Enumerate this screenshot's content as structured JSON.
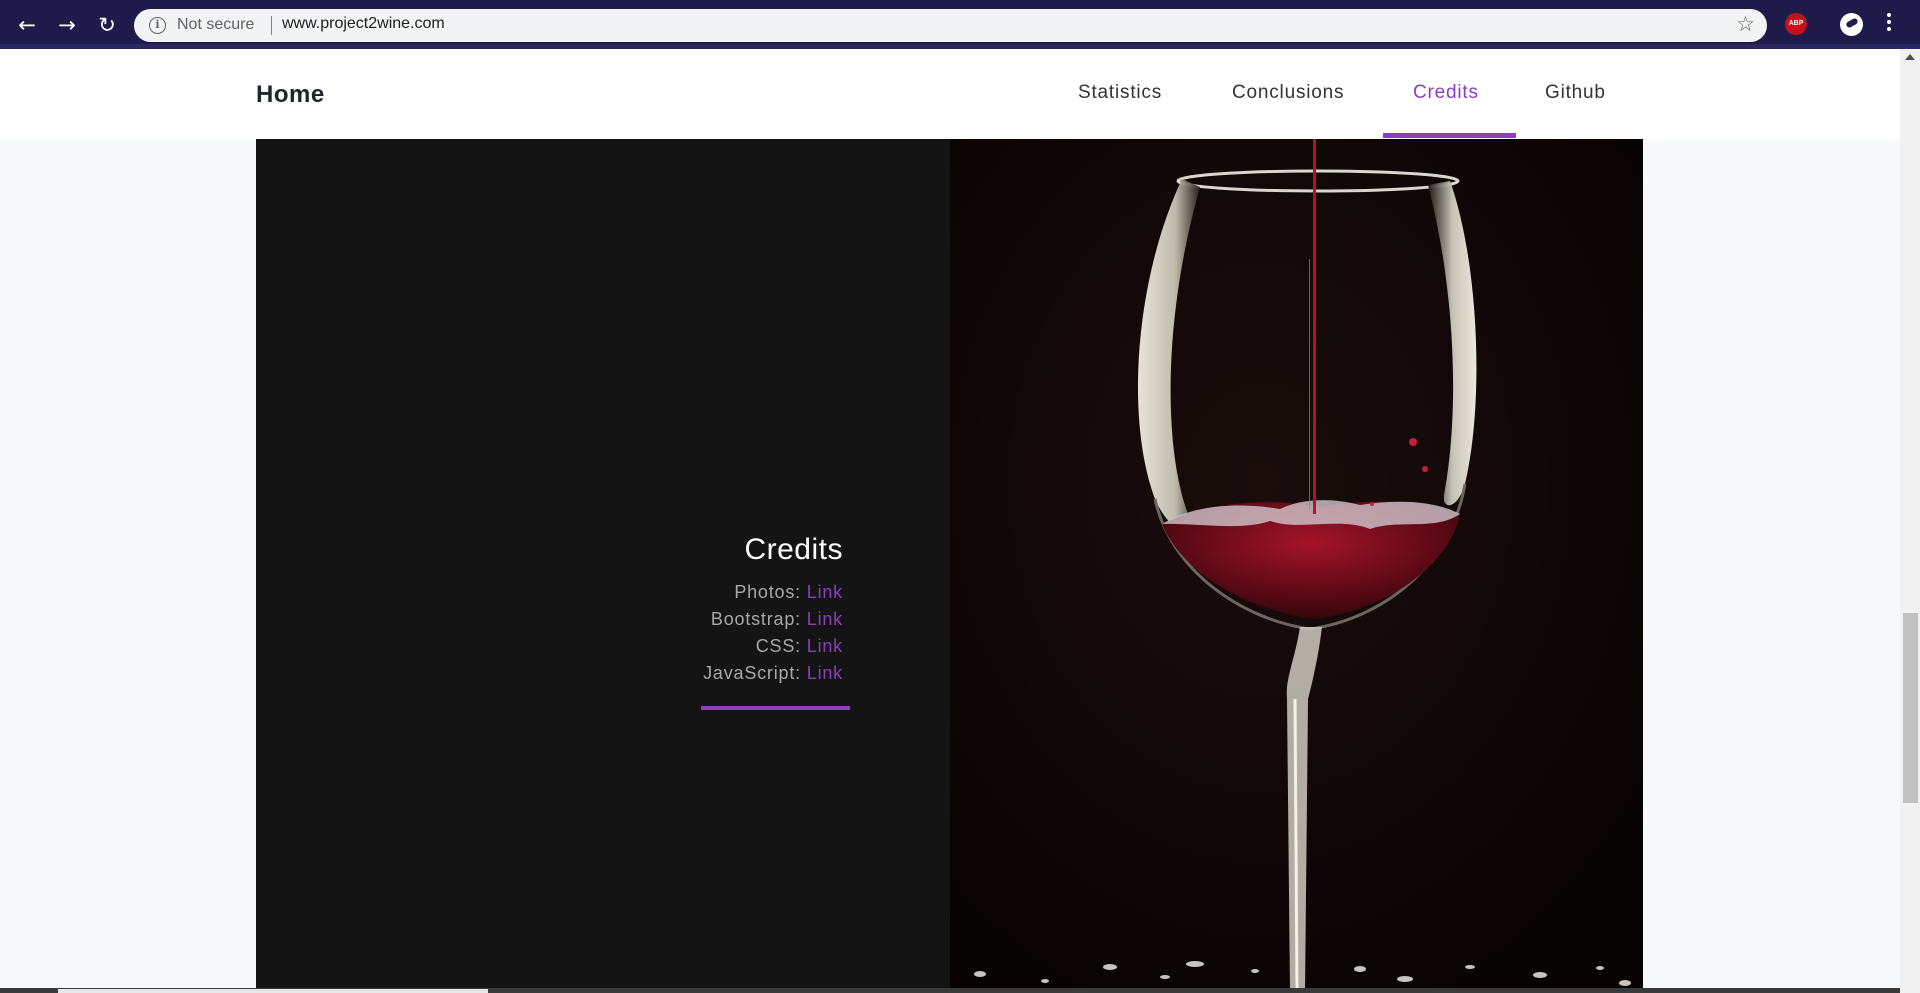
{
  "browser": {
    "security_label": "Not secure",
    "url": "www.project2wine.com",
    "back_icon": "arrow-left-icon",
    "forward_icon": "arrow-right-icon",
    "reload_icon": "reload-icon",
    "info_icon": "info-icon",
    "bookmark_icon": "star-icon",
    "adblock_label": "ABP",
    "menu_icon": "kebab-menu-icon"
  },
  "navbar": {
    "brand": "Home",
    "links": [
      {
        "label": "Statistics",
        "active": false
      },
      {
        "label": "Conclusions",
        "active": false
      },
      {
        "label": "Credits",
        "active": true
      },
      {
        "label": "Github",
        "active": false
      }
    ]
  },
  "credits": {
    "title": "Credits",
    "rows": [
      {
        "label": "Photos:",
        "link": "Link"
      },
      {
        "label": "Bootstrap:",
        "link": "Link"
      },
      {
        "label": "CSS:",
        "link": "Link"
      },
      {
        "label": "JavaScript:",
        "link": "Link"
      }
    ]
  },
  "colors": {
    "accent": "#8a3fbf",
    "chrome_bg": "#1e1b4a",
    "panel_dark": "#141414",
    "wine_red": "#8b0a1a"
  }
}
